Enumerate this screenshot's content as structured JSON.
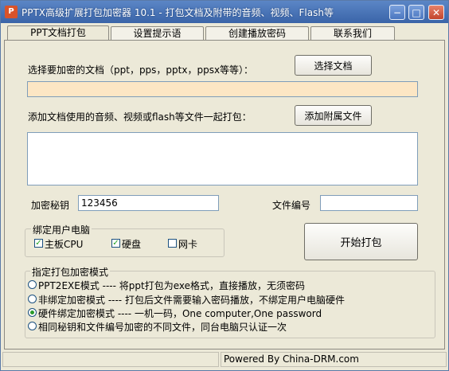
{
  "window": {
    "title": "PPTX高级扩展打包加密器 10.1 - 打包文档及附带的音频、视频、Flash等",
    "min_glyph": "−",
    "max_glyph": "□",
    "close_glyph": "✕",
    "icon_glyph": "P"
  },
  "tabs": [
    "PPT文档打包",
    "设置提示语",
    "创建播放密码",
    "联系我们"
  ],
  "doc": {
    "label": "选择要加密的文档（ppt，pps，pptx，ppsx等等）：",
    "button": "选择文档",
    "path_value": ""
  },
  "attach": {
    "label": "添加文档使用的音频、视频或flash等文件一起打包：",
    "button": "添加附属文件"
  },
  "key": {
    "label": "加密秘钥",
    "value": "123456"
  },
  "file_no": {
    "label": "文件编号",
    "value": ""
  },
  "bind": {
    "legend": "绑定用户电脑",
    "options": [
      {
        "label": "主板CPU",
        "checked": true
      },
      {
        "label": "硬盘",
        "checked": true
      },
      {
        "label": "网卡",
        "checked": false
      }
    ]
  },
  "start_button": "开始打包",
  "mode": {
    "legend": "指定打包加密模式",
    "options": [
      {
        "label": "PPT2EXE模式 ---- 将ppt打包为exe格式，直接播放，无须密码",
        "selected": false
      },
      {
        "label": "非绑定加密模式 ---- 打包后文件需要输入密码播放，不绑定用户电脑硬件",
        "selected": false
      },
      {
        "label": "硬件绑定加密模式 ---- 一机一码，One computer,One password",
        "selected": true
      },
      {
        "label": "相同秘钥和文件编号加密的不同文件，同台电脑只认证一次",
        "selected": false
      }
    ]
  },
  "status": {
    "text": "Powered By China-DRM.com"
  },
  "colors": {
    "path_field_bg": "#fce6c4",
    "title_bar": "#3a64a8",
    "check_mark": "#21a121"
  }
}
